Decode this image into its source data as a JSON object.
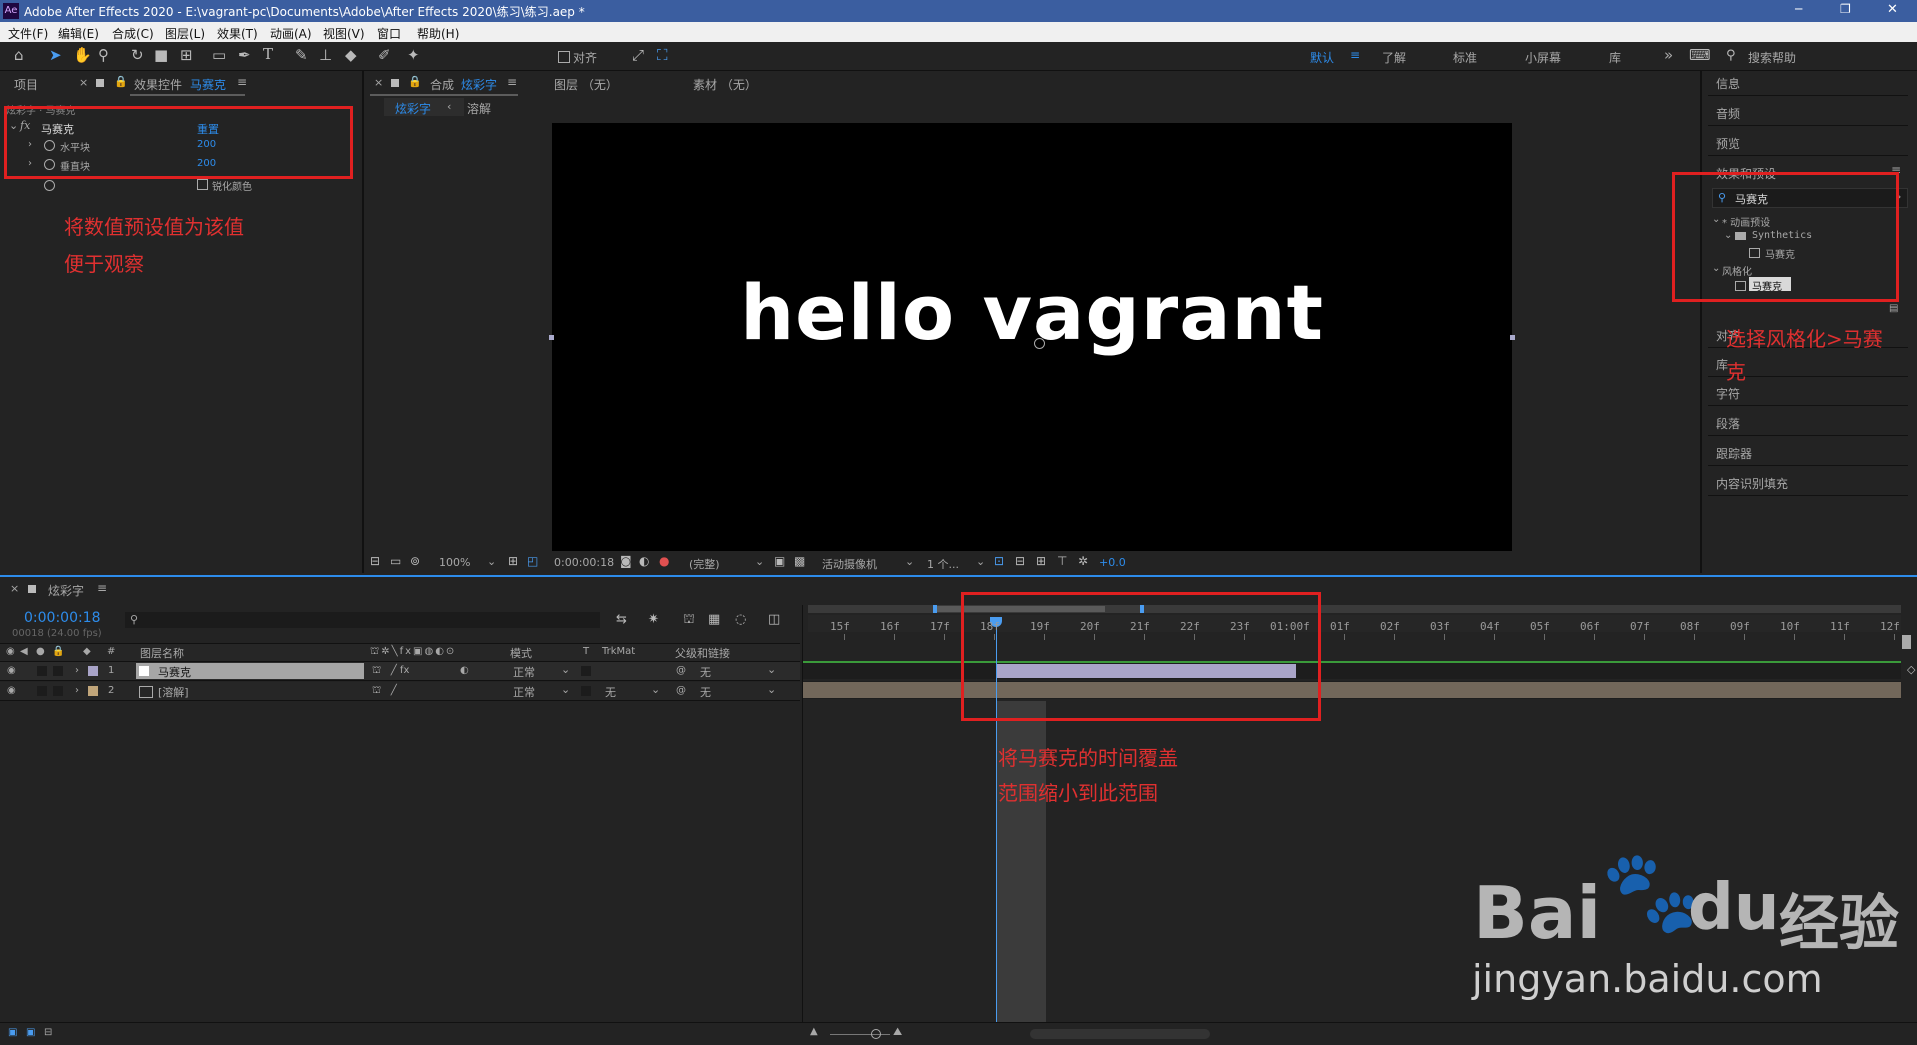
{
  "titlebar": {
    "app_icon": "Ae",
    "title": "Adobe After Effects 2020 - E:\\vagrant-pc\\Documents\\Adobe\\After Effects 2020\\练习\\练习.aep *",
    "minimize": "─",
    "restore": "❐",
    "close": "✕"
  },
  "menu": [
    "文件(F)",
    "编辑(E)",
    "合成(C)",
    "图层(L)",
    "效果(T)",
    "动画(A)",
    "视图(V)",
    "窗口",
    "帮助(H)"
  ],
  "toolbar": {
    "snap_label": "对齐",
    "workspaces": [
      "默认",
      "了解",
      "标准",
      "小屏幕",
      "库"
    ],
    "active_workspace": "默认",
    "more": "»",
    "search_help": "搜索帮助"
  },
  "project_panel": {
    "tab_project": "项目"
  },
  "effect_controls": {
    "tab_prefix": "效果控件",
    "tab_layer": "马赛克",
    "breadcrumb": "炫彩字 · 马赛克",
    "fx_name": "马赛克",
    "reset": "重置",
    "fx_symbol": "fx",
    "params": [
      {
        "name": "水平块",
        "value": "200"
      },
      {
        "name": "垂直块",
        "value": "200"
      }
    ],
    "checkbox_label": "锐化颜色"
  },
  "composition": {
    "tab_prefix": "合成",
    "tab_name": "炫彩字",
    "layer_tab": "图层 （无）",
    "footage_tab": "素材 （无）",
    "flow": [
      "炫彩字",
      "溶解"
    ],
    "viewer_text": "hello vagrant",
    "zoom": "100%",
    "timecode": "0:00:00:18",
    "resolution": "(完整)",
    "camera": "活动摄像机",
    "views": "1 个...",
    "exposure": "+0.0"
  },
  "right_panels": {
    "items_top": [
      "信息",
      "音频",
      "预览"
    ],
    "effects_presets_label": "效果和预设",
    "search_value": "马赛克",
    "tree": [
      {
        "label": "* 动画预设",
        "indent": 0
      },
      {
        "label": "Synthetics",
        "indent": 1
      },
      {
        "label": "马赛克",
        "indent": 2
      },
      {
        "label": "风格化",
        "indent": 0
      },
      {
        "label": "马赛克",
        "indent": 1,
        "selected": true
      }
    ],
    "items_bottom": [
      "对齐",
      "库",
      "字符",
      "段落",
      "跟踪器",
      "内容识别填充"
    ]
  },
  "timeline": {
    "tab_name": "炫彩字",
    "timecode": "0:00:00:18",
    "fps": "00018 (24.00 fps)",
    "columns": {
      "layer_name": "图层名称",
      "mode": "模式",
      "t": "T",
      "trkmat": "TrkMat",
      "parent": "父级和链接",
      "num": "#"
    },
    "layers": [
      {
        "num": "1",
        "name": "马赛克",
        "mode": "正常",
        "trkmat": "",
        "parent": "无",
        "color": "#a9a4c8"
      },
      {
        "num": "2",
        "name": "[溶解]",
        "mode": "正常",
        "trkmat": "无",
        "parent": "无",
        "color": "#c0a57a"
      }
    ],
    "ruler": [
      "15f",
      "16f",
      "17f",
      "18f",
      "19f",
      "20f",
      "21f",
      "22f",
      "23f",
      "01:00f",
      "01f",
      "02f",
      "03f",
      "04f",
      "05f",
      "06f",
      "07f",
      "08f",
      "09f",
      "10f",
      "11f",
      "12f"
    ]
  },
  "annotations": {
    "left_line1": "将数值预设值为该值",
    "left_line2": "便于观察",
    "right_line1": "选择风格化>马赛",
    "right_line2": "克",
    "bottom_line1": "将马赛克的时间覆盖",
    "bottom_line2": "范围缩小到此范围"
  },
  "watermark": {
    "brand": "Bai",
    "brand2": "du",
    "cn": "经验",
    "url": "jingyan.baidu.com"
  }
}
